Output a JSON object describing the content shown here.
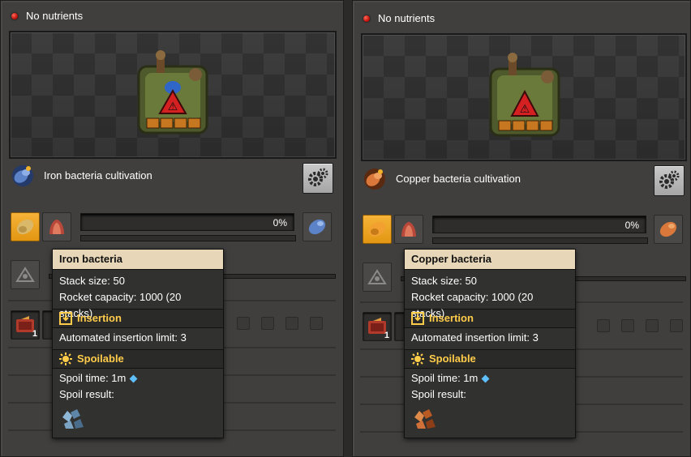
{
  "panels": [
    {
      "status_text": "No nutrients",
      "recipe_label": "Iron bacteria cultivation",
      "progress_text": "0%",
      "progress_fraction": 0,
      "tooltip": {
        "title": "Iron bacteria",
        "stack_size": "Stack size: 50",
        "rocket_capacity": "Rocket capacity: 1000 (20 stacks)",
        "insertion_title": "Insertion",
        "insertion_limit": "Automated insertion limit: 3",
        "spoilable_title": "Spoilable",
        "spoil_time": "Spoil time: 1m",
        "spoil_result": "Spoil result:",
        "spoil_result_icon": "iron-ore-icon"
      },
      "module_count": "1"
    },
    {
      "status_text": "No nutrients",
      "recipe_label": "Copper bacteria cultivation",
      "progress_text": "0%",
      "progress_fraction": 0,
      "tooltip": {
        "title": "Copper bacteria",
        "stack_size": "Stack size: 50",
        "rocket_capacity": "Rocket capacity: 1000 (20 stacks)",
        "insertion_title": "Insertion",
        "insertion_limit": "Automated insertion limit: 3",
        "spoilable_title": "Spoilable",
        "spoil_time": "Spoil time: 1m",
        "spoil_result": "Spoil result:",
        "spoil_result_icon": "copper-ore-icon"
      },
      "module_count": "1"
    }
  ],
  "colors": {
    "status_red": "#c1120b",
    "accent_gold": "#ffcc4a",
    "tooltip_header": "#e7d6b7",
    "slot_highlight": "#f5b338"
  }
}
